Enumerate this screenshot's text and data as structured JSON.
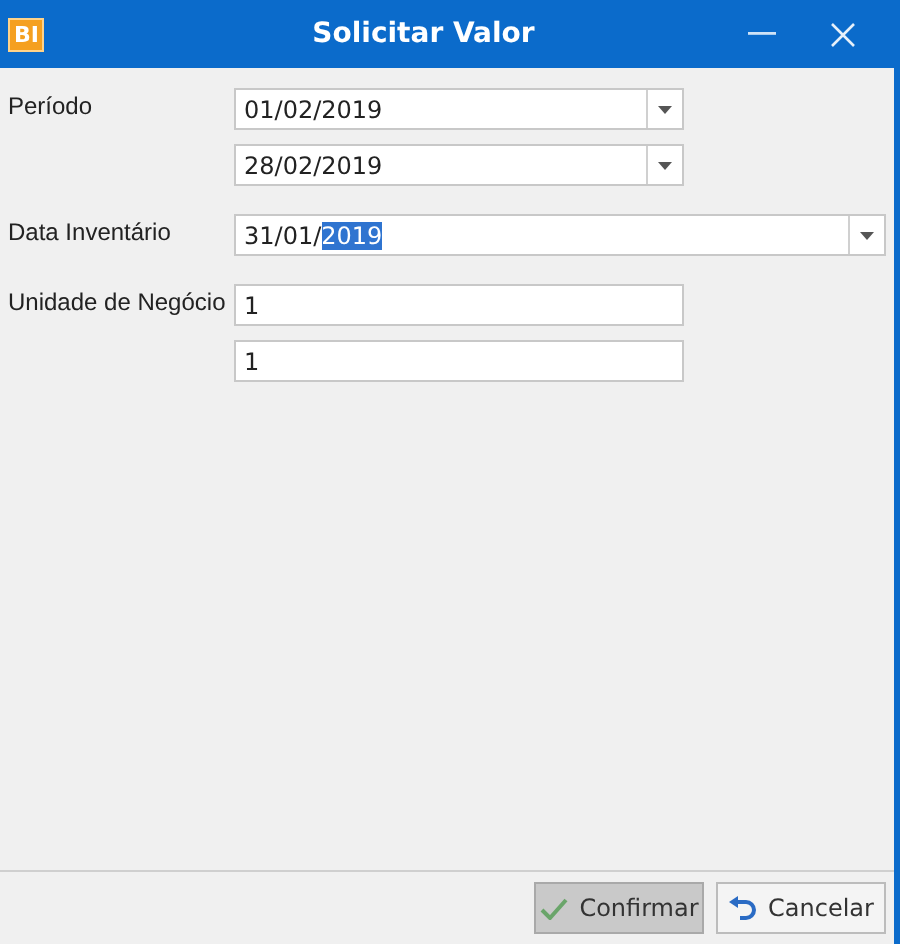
{
  "window": {
    "title": "Solicitar Valor",
    "app_badge": "BI"
  },
  "fields": [
    {
      "label": "Período",
      "kind": "combo",
      "inputs": [
        {
          "value": "01/02/2019",
          "wide": false
        },
        {
          "value": "28/02/2019",
          "wide": false
        }
      ]
    },
    {
      "label": "Data Inventário",
      "kind": "combo",
      "inputs": [
        {
          "value": "31/01/",
          "selection": "2019",
          "wide": true
        }
      ]
    },
    {
      "label": "Unidade de Negócio",
      "kind": "text",
      "inputs": [
        {
          "value": "1",
          "wide": false
        },
        {
          "value": "1",
          "wide": false
        }
      ]
    }
  ],
  "buttons": [
    {
      "label": "Confirmar",
      "kind": "confirm",
      "hovered": true
    },
    {
      "label": "Cancelar",
      "kind": "cancel",
      "hovered": false
    }
  ]
}
